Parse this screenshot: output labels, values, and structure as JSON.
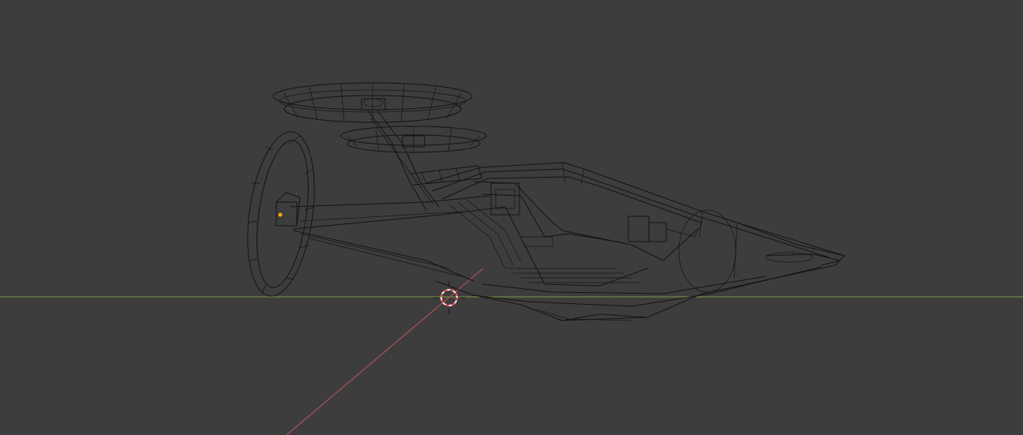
{
  "app": {
    "name": "3D viewport",
    "shading": "wireframe"
  },
  "colors": {
    "background": "#3d3d3d",
    "wireframe": "#141414",
    "x_axis": "#b8525b",
    "y_axis": "#7c9a3f",
    "cursor_red": "#ee3a3a",
    "cursor_white": "#f0f0f0",
    "origin": "#f5a623"
  },
  "icons": {
    "cursor": "3d-cursor-icon",
    "origin": "object-origin-icon"
  }
}
